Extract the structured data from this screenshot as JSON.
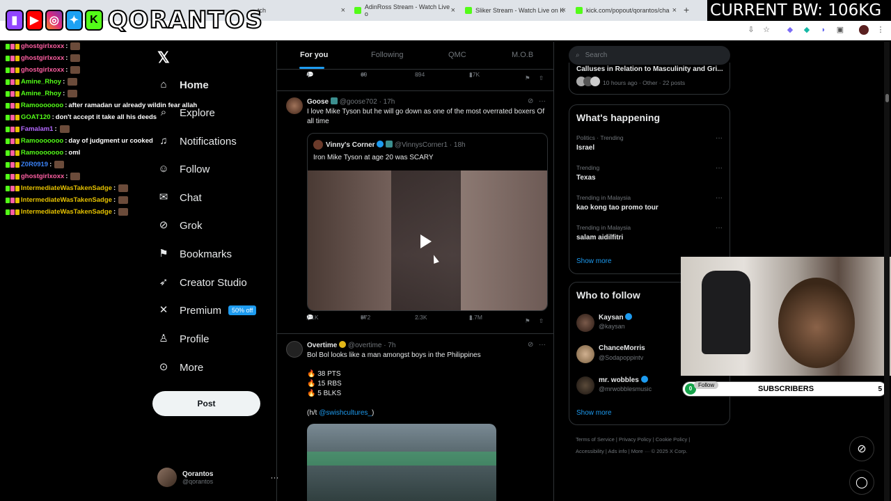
{
  "browser": {
    "tabs": [
      {
        "label": "tch",
        "close": "×"
      },
      {
        "label": "AdinRoss Stream - Watch Live o",
        "close": "×"
      },
      {
        "label": "Sliker Stream - Watch Live on K",
        "close": "×"
      },
      {
        "label": "kick.com/popout/qorantos/cha",
        "close": "×"
      }
    ],
    "new_tab": "+"
  },
  "overlay": {
    "brand": "QORANTOS",
    "bw": "CURRENT BW: 106KG",
    "social_icons": [
      "twitch-icon",
      "youtube-icon",
      "instagram-icon",
      "twitter-icon",
      "kick-icon"
    ]
  },
  "chat": {
    "messages": [
      {
        "user": "ghostgirlxoxx",
        "color": "#ff5fa2",
        "text": "",
        "emote": true
      },
      {
        "user": "ghostgirlxoxx",
        "color": "#ff5fa2",
        "text": "",
        "emote": true
      },
      {
        "user": "ghostgirlxoxx",
        "color": "#ff5fa2",
        "text": "",
        "emote": true
      },
      {
        "user": "Amine_Rhoy",
        "color": "#53fc18",
        "text": "",
        "emote": true
      },
      {
        "user": "Amine_Rhoy",
        "color": "#53fc18",
        "text": "",
        "emote": true
      },
      {
        "user": "Ramooooooo",
        "color": "#53fc18",
        "text": "after ramadan ur already wildin fear allah",
        "emote": false
      },
      {
        "user": "GOAT120",
        "color": "#53fc18",
        "text": "don't accept it take all his deeds",
        "emote": false
      },
      {
        "user": "Famalam1",
        "color": "#b469ff",
        "text": "",
        "emote": true
      },
      {
        "user": "Ramooooooo",
        "color": "#53fc18",
        "text": "day of judgment ur cooked",
        "emote": false
      },
      {
        "user": "Ramooooooo",
        "color": "#53fc18",
        "text": "oml",
        "emote": false
      },
      {
        "user": "Z0R0919",
        "color": "#3b82f6",
        "text": "",
        "emote": true
      },
      {
        "user": "ghostgirlxoxx",
        "color": "#ff5fa2",
        "text": "",
        "emote": true
      },
      {
        "user": "IntermediateWasTakenSadge",
        "color": "#e5c100",
        "text": "",
        "emote": true
      },
      {
        "user": "IntermediateWasTakenSadge",
        "color": "#e5c100",
        "text": "",
        "emote": true
      },
      {
        "user": "IntermediateWasTakenSadge",
        "color": "#e5c100",
        "text": "",
        "emote": true
      }
    ]
  },
  "nav": {
    "items": [
      {
        "label": "Home",
        "icon": "home-icon"
      },
      {
        "label": "Explore",
        "icon": "search-icon"
      },
      {
        "label": "Notifications",
        "icon": "bell-icon"
      },
      {
        "label": "Follow",
        "icon": "person-plus-icon"
      },
      {
        "label": "Chat",
        "icon": "mail-icon"
      },
      {
        "label": "Grok",
        "icon": "grok-icon"
      },
      {
        "label": "Bookmarks",
        "icon": "bookmark-icon"
      },
      {
        "label": "Creator Studio",
        "icon": "rocket-icon"
      },
      {
        "label": "Premium",
        "icon": "x-icon",
        "badge": "50% off"
      },
      {
        "label": "Profile",
        "icon": "person-icon"
      },
      {
        "label": "More",
        "icon": "more-circle-icon"
      }
    ],
    "post": "Post",
    "account": {
      "name": "Qorantos",
      "handle": "@qorantos",
      "more": "···"
    }
  },
  "timeline": {
    "tabs": [
      "For you",
      "Following",
      "QMC",
      "M.O.B"
    ],
    "prev_actions": {
      "replies": "4",
      "reposts": "69",
      "likes": "894",
      "views": "17K"
    },
    "tweet1": {
      "name": "Goose",
      "handle": "@goose702",
      "time": "· 17h",
      "text": "I love Mike Tyson but he will go down as one of the most overrated boxers Of all time",
      "quote": {
        "name": "Vinny's Corner",
        "handle": "@VinnysCorner1",
        "time": "· 18h",
        "text": "Iron Mike Tyson at age 20 was SCARY"
      },
      "actions": {
        "replies": "2.1K",
        "reposts": "572",
        "likes": "2.3K",
        "views": "1.7M"
      }
    },
    "tweet2": {
      "name": "Overtime",
      "handle": "@overtime",
      "time": "· 7h",
      "line1": "Bol Bol looks like a man amongst boys in the Philippines",
      "stats": [
        "38 PTS",
        "15 RBS",
        "5 BLKS"
      ],
      "ht_prefix": "(h/t ",
      "ht_link": "@swishcultures_",
      "ht_suffix": ")"
    }
  },
  "right": {
    "search_placeholder": "Search",
    "top_card": {
      "title": "Calluses in Relation to Masculinity and Gri...",
      "meta": "10 hours ago · Other · 22 posts"
    },
    "happening": {
      "title": "What's happening",
      "trends": [
        {
          "cat": "Politics · Trending",
          "name": "Israel"
        },
        {
          "cat": "Trending",
          "name": "Texas"
        },
        {
          "cat": "Trending in Malaysia",
          "name": "kao kong tao promo tour"
        },
        {
          "cat": "Trending in Malaysia",
          "name": "salam aidilfitri"
        }
      ],
      "show_more": "Show more"
    },
    "who_to_follow": {
      "title": "Who to follow",
      "users": [
        {
          "name": "Kaysan",
          "handle": "@kaysan"
        },
        {
          "name": "ChanceMorris",
          "handle": "@Sodapoppintv"
        },
        {
          "name": "mr. wobbles",
          "handle": "@mrwobblesmusic"
        }
      ],
      "show_more": "Show more"
    },
    "footer": {
      "line1": "Terms of Service  |  Privacy Policy  |  Cookie Policy  |",
      "line2": "Accessibility  |  Ads info  |  More ···  © 2025 X Corp."
    }
  },
  "widget": {
    "subs_count": "0",
    "follow_label": "Follow",
    "subs_label": "SUBSCRIBERS",
    "subs_goal": "5"
  }
}
